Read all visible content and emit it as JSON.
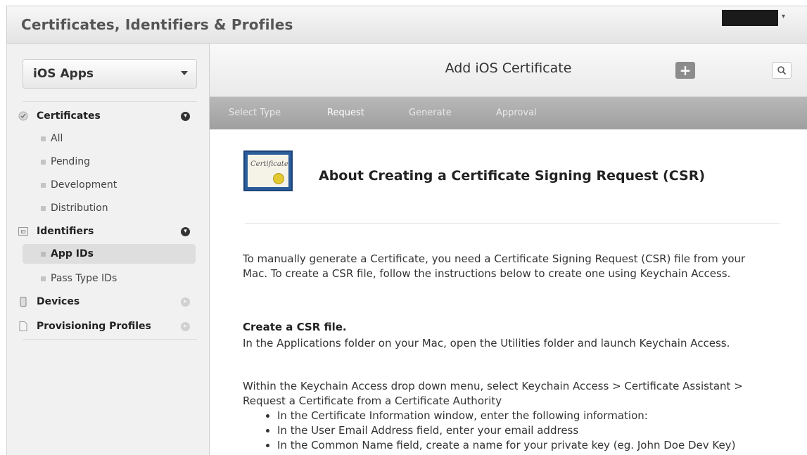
{
  "app": {
    "title": "Certificates, Identifiers & Profiles"
  },
  "sidebar": {
    "platform": "iOS Apps",
    "sections": [
      {
        "label": "Certificates",
        "icon": "certificate-seal-icon",
        "expanded": true,
        "items": [
          "All",
          "Pending",
          "Development",
          "Distribution"
        ]
      },
      {
        "label": "Identifiers",
        "icon": "id-badge-icon",
        "expanded": true,
        "items": [
          "App IDs",
          "Pass Type IDs"
        ],
        "selected": "App IDs"
      },
      {
        "label": "Devices",
        "icon": "device-icon",
        "expanded": false,
        "items": []
      },
      {
        "label": "Provisioning Profiles",
        "icon": "document-icon",
        "expanded": false,
        "items": []
      }
    ]
  },
  "main": {
    "title": "Add iOS Certificate",
    "steps": [
      "Select Type",
      "Request",
      "Generate",
      "Approval"
    ],
    "active_step": "Request",
    "cert_image_text": "Certificate",
    "heading": "About Creating a Certificate Signing Request (CSR)",
    "intro_line1": "To manually generate a Certificate, you need a Certificate Signing Request (CSR) file from your",
    "intro_line2": "Mac. To create a CSR file, follow the instructions below to create one using Keychain Access.",
    "csr_heading": "Create a CSR file.",
    "csr_text": "In the Applications folder on your Mac, open the Utilities folder and launch Keychain Access.",
    "keychain_line1": "Within the Keychain Access drop down menu, select Keychain Access > Certificate Assistant >",
    "keychain_line2": "Request a Certificate from a Certificate Authority",
    "bullets": [
      "In the Certificate Information window, enter the following information:",
      "In the User Email Address field, enter your email address",
      "In the Common Name field, create a name for your private key (eg. John Doe Dev Key)"
    ]
  },
  "colors": {
    "step_bar": "#a9a9a9",
    "selected_item": "#dedede",
    "cert_blue": "#2a5c9a",
    "seal_gold": "#e4c832"
  }
}
